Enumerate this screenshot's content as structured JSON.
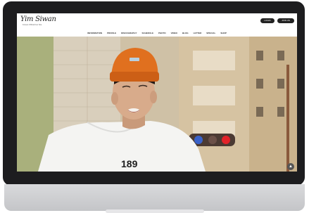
{
  "site": {
    "logo": "Yim Siwan",
    "tagline": "Korean Official Fan Site",
    "header_buttons": [
      "LOGIN",
      "JOIN US"
    ]
  },
  "nav": {
    "items": [
      "INFORMATION",
      "PROFILE",
      "DISCOGRAPHY",
      "SCHEDULE",
      "PHOTO",
      "VIDEO",
      "BLOG",
      "LETTER",
      "SPECIAL",
      "SHOP"
    ]
  },
  "hero": {
    "shirt_text": "189"
  },
  "icons": [
    "scroll-up-icon"
  ],
  "colors": {
    "bezel": "#1d1d1f",
    "beanie": "#e0701f",
    "traffic_red": "#e2232a",
    "traffic_blue": "#3a62c9"
  }
}
